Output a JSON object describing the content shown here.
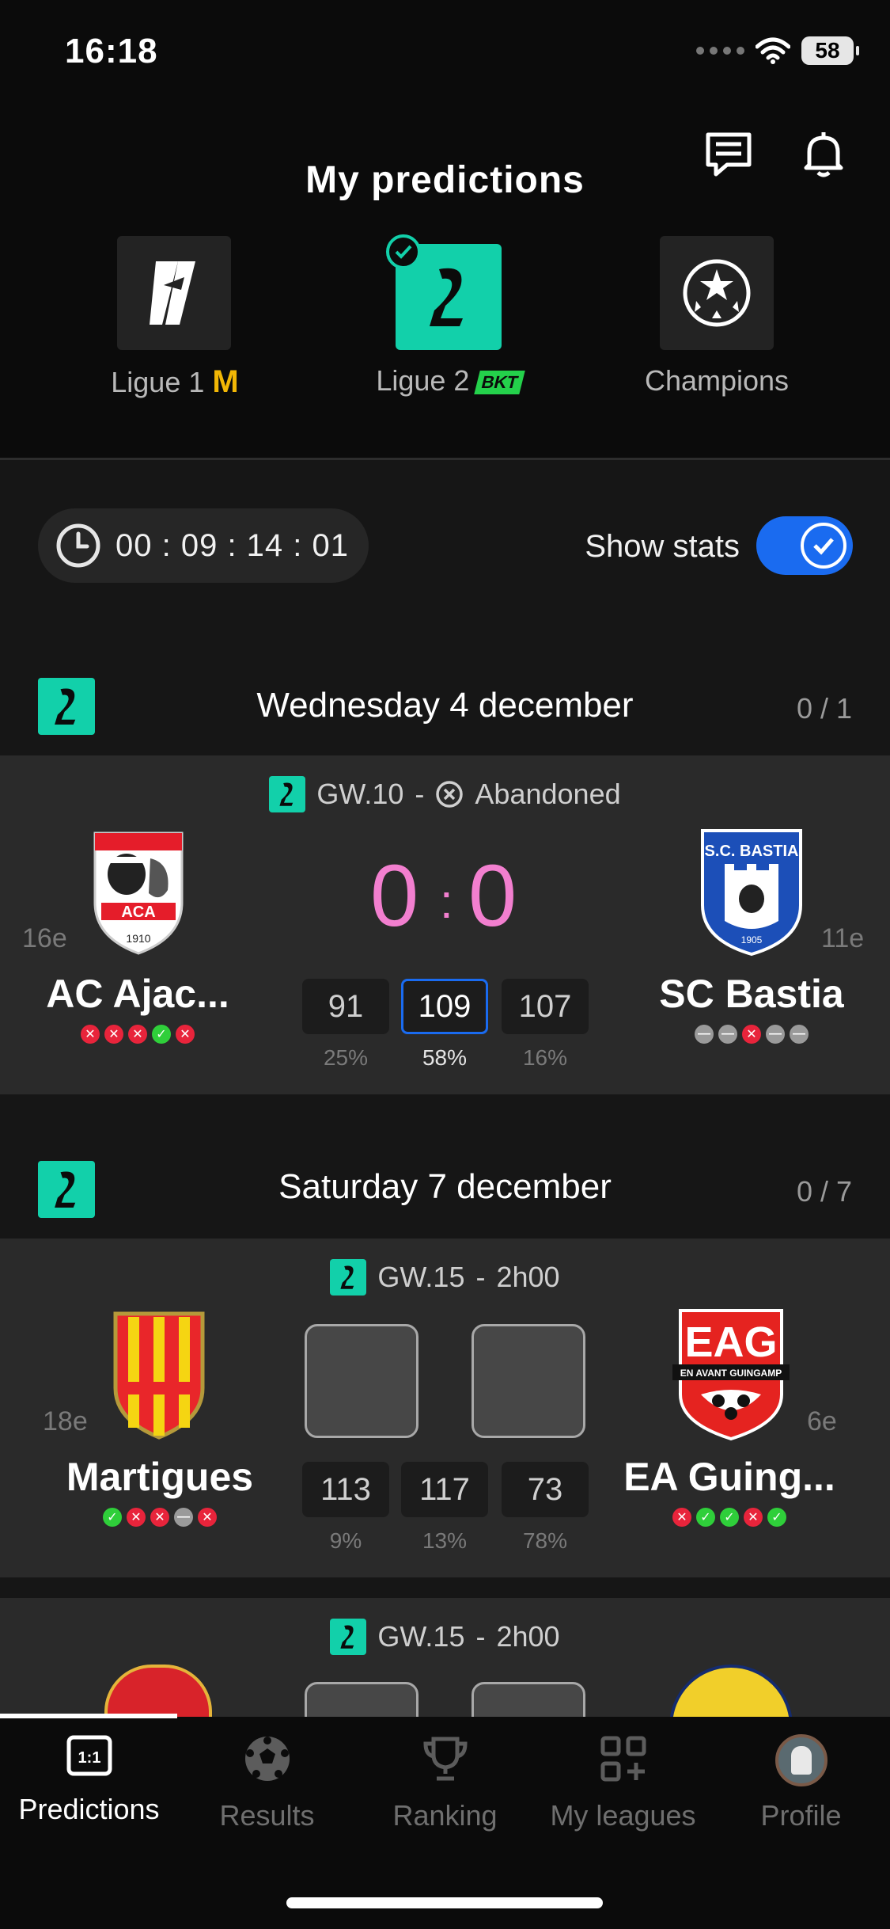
{
  "status_bar": {
    "time": "16:18",
    "battery": "58"
  },
  "header": {
    "title": "My predictions"
  },
  "competitions": [
    {
      "label": "Ligue 1",
      "active": false
    },
    {
      "label": "Ligue 2",
      "active": true
    },
    {
      "label": "Champions",
      "active": false
    }
  ],
  "timer": {
    "value": "00 : 09 : 14 : 01"
  },
  "stats_toggle": {
    "label": "Show stats",
    "on": true
  },
  "days": [
    {
      "title": "Wednesday 4 december",
      "count": "0 / 1"
    },
    {
      "title": "Saturday 7 december",
      "count": "0 / 7"
    }
  ],
  "matches": [
    {
      "gw": "GW.10",
      "sep": "-",
      "status": "Abandoned",
      "home": {
        "name": "AC Ajac...",
        "rank": "16e",
        "form": [
          "L",
          "L",
          "L",
          "W",
          "L"
        ]
      },
      "away": {
        "name": "SC Bastia",
        "rank": "11e",
        "form": [
          "D",
          "D",
          "L",
          "D",
          "D"
        ]
      },
      "score": {
        "home": "0",
        "sep": ":",
        "away": "0"
      },
      "odds": [
        {
          "value": "91",
          "pct": "25%"
        },
        {
          "value": "109",
          "pct": "58%",
          "selected": true
        },
        {
          "value": "107",
          "pct": "16%"
        }
      ]
    },
    {
      "gw": "GW.15",
      "sep": "-",
      "status": "2h00",
      "home": {
        "name": "Martigues",
        "rank": "18e",
        "form": [
          "W",
          "L",
          "L",
          "D",
          "L"
        ]
      },
      "away": {
        "name": "EA Guing...",
        "rank": "6e",
        "form": [
          "L",
          "W",
          "W",
          "L",
          "W"
        ]
      },
      "odds": [
        {
          "value": "113",
          "pct": "9%"
        },
        {
          "value": "117",
          "pct": "13%"
        },
        {
          "value": "73",
          "pct": "78%"
        }
      ]
    },
    {
      "gw": "GW.15",
      "sep": "-",
      "status": "2h00"
    }
  ],
  "crest_text": {
    "bastia": "S.C. BASTIA",
    "bastia_year": "1905",
    "ajaccio": "ACA",
    "ajaccio_year": "1910",
    "eag": "EAG",
    "eag_sub": "EN AVANT GUINGAMP"
  },
  "tabs": [
    {
      "label": "Predictions",
      "icon": "score-icon",
      "active": true
    },
    {
      "label": "Results",
      "icon": "soccer-ball-icon"
    },
    {
      "label": "Ranking",
      "icon": "trophy-icon"
    },
    {
      "label": "My leagues",
      "icon": "grid-plus-icon"
    },
    {
      "label": "Profile",
      "icon": "avatar-icon"
    }
  ],
  "colors": {
    "accent": "#12d0aa",
    "blue": "#1a6bf0",
    "score": "#f27fcf",
    "win": "#2fcf3a",
    "loss": "#e8243b",
    "draw": "#9a9a9a"
  }
}
